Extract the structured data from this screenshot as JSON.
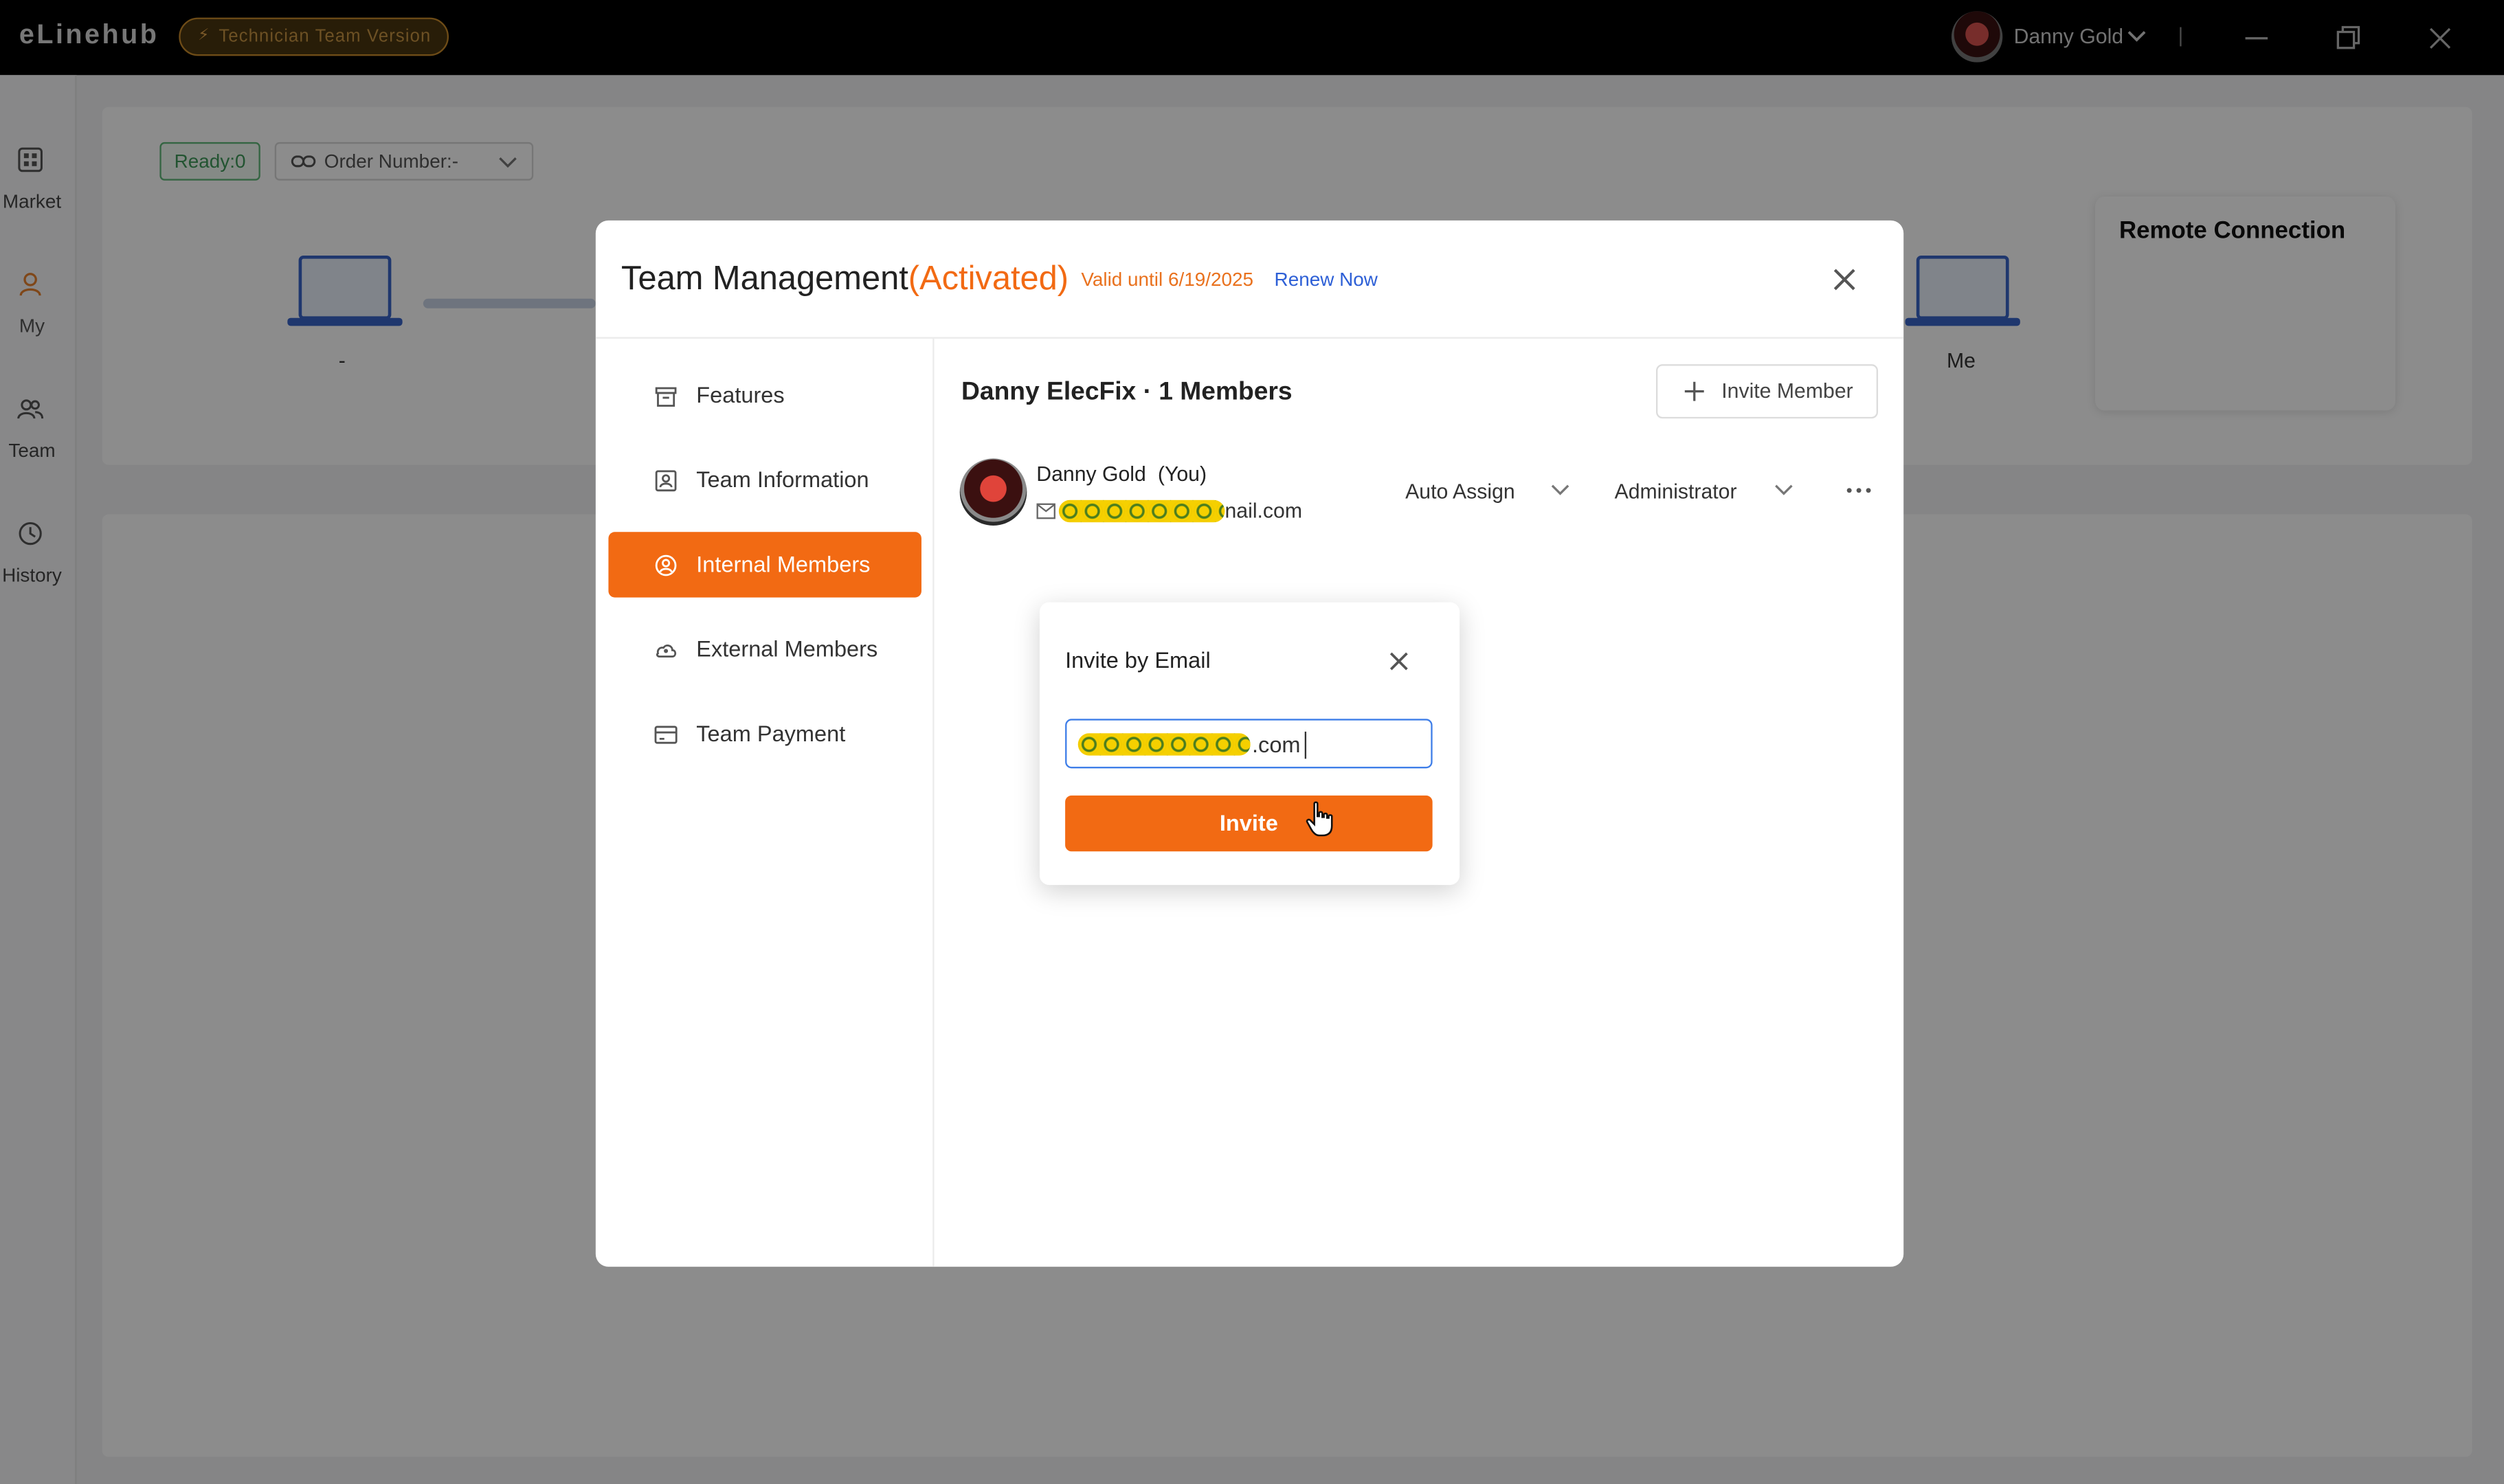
{
  "app": {
    "brand": "eLinehub",
    "version_badge": "Technician Team Version",
    "user_name": "Danny Gold"
  },
  "nav": [
    {
      "label": "Market",
      "icon": "grid-icon"
    },
    {
      "label": "My",
      "icon": "user-icon"
    },
    {
      "label": "Team",
      "icon": "team-icon"
    },
    {
      "label": "History",
      "icon": "history-icon"
    }
  ],
  "connection": {
    "ready": "Ready:0",
    "order_number": "Order Number:-",
    "left_device_label": "-",
    "right_device_label": "Me",
    "remote_title": "Remote Connection"
  },
  "team_modal": {
    "title": "Team Management",
    "status": "(Activated)",
    "valid_until": "Valid until 6/19/2025",
    "renew": "Renew Now",
    "sidebar": [
      {
        "label": "Features",
        "icon": "box-icon"
      },
      {
        "label": "Team Information",
        "icon": "id-card-icon"
      },
      {
        "label": "Internal Members",
        "icon": "member-icon",
        "active": true
      },
      {
        "label": "External Members",
        "icon": "cloud-member-icon"
      },
      {
        "label": "Team Payment",
        "icon": "card-icon"
      }
    ],
    "team_header": "Danny ElecFix · 1 Members",
    "invite_member_button": "Invite Member",
    "member": {
      "name": "Danny Gold",
      "you": "(You)",
      "email_visible_suffix": "nail.com",
      "assign": "Auto Assign",
      "role": "Administrator"
    }
  },
  "invite_dialog": {
    "title": "Invite by Email",
    "input_visible_suffix": ".com",
    "button": "Invite"
  },
  "colors": {
    "accent": "#f26a13",
    "link": "#2d5fd6",
    "ready_green": "#3f9a5a"
  }
}
